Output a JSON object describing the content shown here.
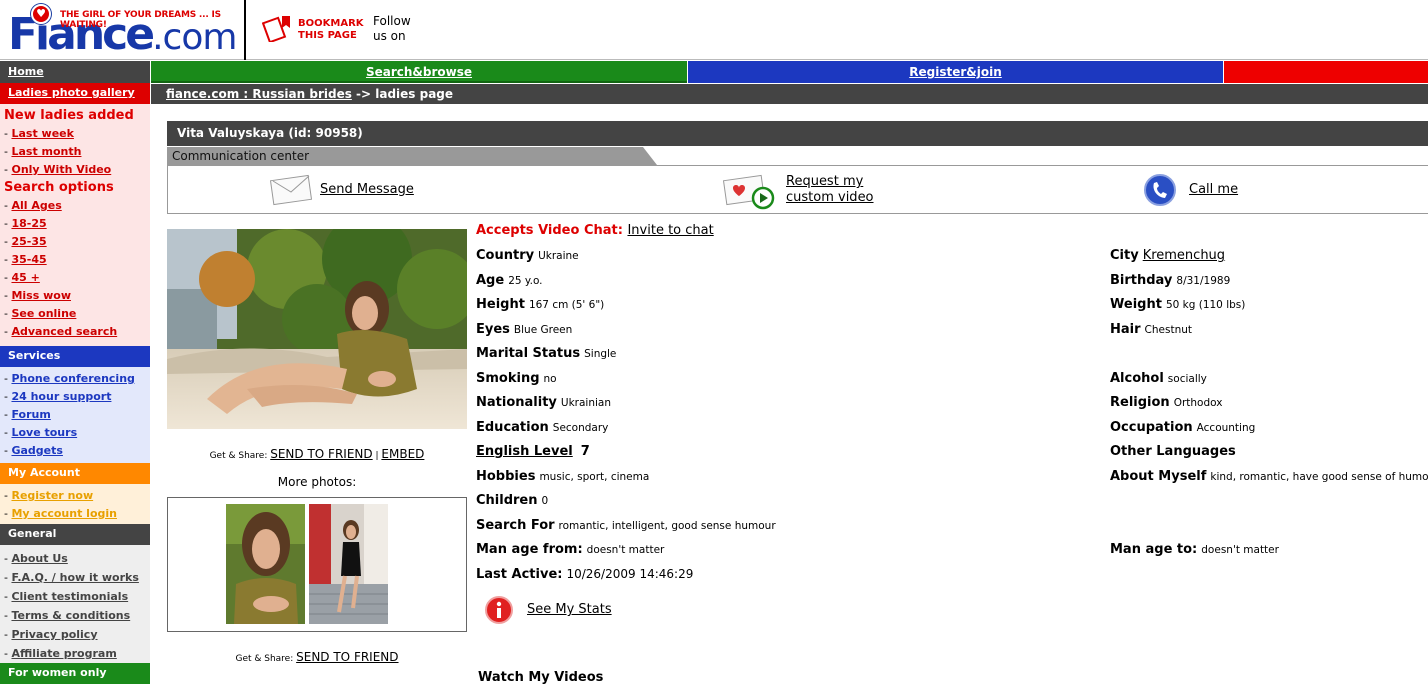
{
  "header": {
    "tagline": "THE GIRL OF YOUR DREAMS ... IS WAITING!",
    "logo_word": "Fiance",
    "logo_com": ".com",
    "bookmark_line1": "BOOKMARK",
    "bookmark_line2": "THIS PAGE",
    "follow_line1": "Follow",
    "follow_line2": "us on"
  },
  "nav": {
    "home": "Home",
    "search": "Search&browse",
    "register": "Register&join"
  },
  "sidebar": {
    "gallery": "Ladies photo gallery",
    "new_ladies_title": "New ladies added",
    "new_ladies": [
      "Last week",
      "Last month",
      "Only With Video"
    ],
    "search_title": "Search options",
    "search_options": [
      "All Ages",
      "18-25",
      "25-35",
      "35-45",
      "45 +",
      "Miss wow",
      "See online",
      "Advanced search"
    ],
    "services_title": "Services",
    "services": [
      "Phone conferencing",
      "24 hour support",
      "Forum",
      "Love tours",
      "Gadgets"
    ],
    "account_title": "My Account",
    "account": [
      "Register now",
      "My account login"
    ],
    "general_title": "General",
    "general": [
      "About Us",
      "F.A.Q. / how it works",
      "Client testimonials",
      "Terms & conditions",
      "Privacy policy",
      "Affiliate program"
    ],
    "women_title": "For women only"
  },
  "breadcrumb": {
    "link": "fiance.com : Russian brides",
    "rest": " -> ladies page"
  },
  "profile": {
    "title": "Vita Valuyskaya (id: 90958)",
    "comm_center": "Communication center",
    "send_message": "Send Message",
    "request_video_1": "Request my",
    "request_video_2": "custom video",
    "call_me": "Call me",
    "share_label": "Get & Share: ",
    "send_to_friend": "SEND TO FRIEND",
    "separator": " | ",
    "embed": "EMBED",
    "more_photos": "More photos:",
    "video_chat_label": "Accepts Video Chat:",
    "video_chat_link": "Invite to chat",
    "see_stats": "See My Stats",
    "watch_videos": "Watch My Videos"
  },
  "left_fields": {
    "country": {
      "k": "Country",
      "v": "Ukraine"
    },
    "age": {
      "k": "Age",
      "v": "25 y.o."
    },
    "height": {
      "k": "Height",
      "v": "167 cm (5' 6\")"
    },
    "eyes": {
      "k": "Eyes",
      "v": "Blue Green"
    },
    "marital": {
      "k": "Marital Status",
      "v": "Single"
    },
    "smoking": {
      "k": "Smoking",
      "v": "no"
    },
    "nationality": {
      "k": "Nationality",
      "v": "Ukrainian"
    },
    "education": {
      "k": "Education",
      "v": "Secondary"
    },
    "english": {
      "k": "English Level",
      "v": "7"
    },
    "hobbies": {
      "k": "Hobbies",
      "v": "music, sport, cinema"
    },
    "children": {
      "k": "Children",
      "v": "0"
    },
    "search_for": {
      "k": "Search For",
      "v": "romantic, intelligent, good sense humour"
    },
    "man_age_from": {
      "k": "Man age from:",
      "v": "doesn't matter"
    },
    "last_active": {
      "k": "Last Active:",
      "v": "10/26/2009 14:46:29"
    }
  },
  "right_fields": {
    "city": {
      "k": "City",
      "v": "Kremenchug"
    },
    "birthday": {
      "k": "Birthday",
      "v": "8/31/1989"
    },
    "weight": {
      "k": "Weight",
      "v": "50 kg (110 lbs)"
    },
    "hair": {
      "k": "Hair",
      "v": "Chestnut"
    },
    "alcohol": {
      "k": "Alcohol",
      "v": "socially"
    },
    "religion": {
      "k": "Religion",
      "v": "Orthodox"
    },
    "occupation": {
      "k": "Occupation",
      "v": "Accounting"
    },
    "languages": {
      "k": "Other Languages",
      "v": ""
    },
    "about": {
      "k": "About Myself",
      "v": "kind, romantic, have good sense of humour"
    },
    "man_age_to": {
      "k": "Man age to:",
      "v": "doesn't matter"
    }
  },
  "colors": {
    "brand_blue": "#1738a8",
    "red": "#dd0000",
    "green": "#1a8a1a",
    "dark_grey": "#444444",
    "orange": "#ff8800"
  }
}
